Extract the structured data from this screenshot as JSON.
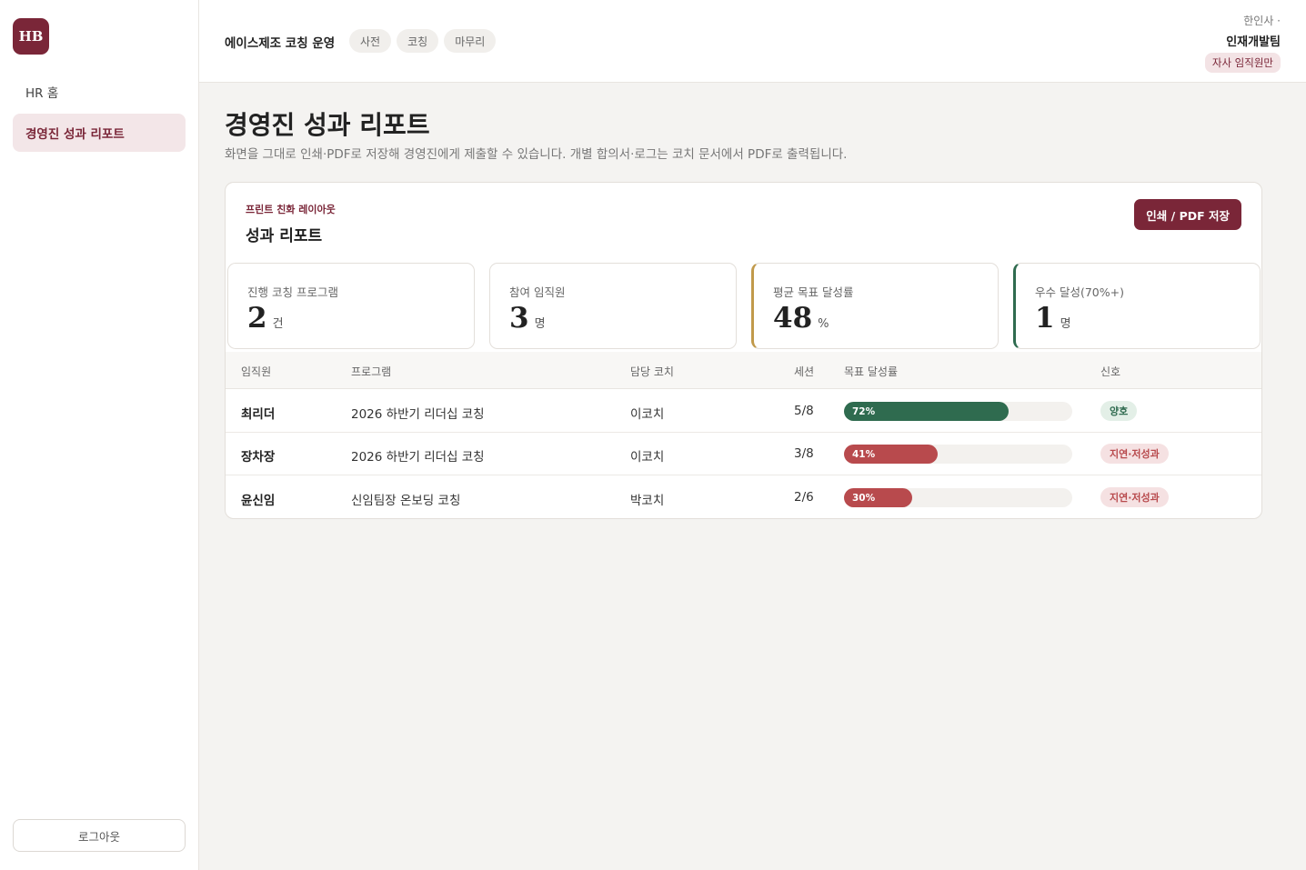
{
  "sidebar": {
    "logo": "HB",
    "items": [
      {
        "label": "HR 홈"
      },
      {
        "label": "경영진 성과 리포트"
      }
    ],
    "logout_label": "로그아웃"
  },
  "header": {
    "app_title": "에이스제조 코칭 운영",
    "phases": [
      "사전",
      "코칭",
      "마무리"
    ],
    "company": "한인사 ·",
    "team": "인재개발팀",
    "scope_badge": "자사 임직원만"
  },
  "main": {
    "title": "경영진 성과 리포트",
    "description": "화면을 그대로 인쇄·PDF로 저장해 경영진에게 제출할 수 있습니다. 개별 합의서·로그는 코치 문서에서 PDF로 출력됩니다.",
    "card": {
      "kicker": "프린트 친화 레이아웃",
      "title": "성과 리포트",
      "print_button": "인쇄 / PDF 저장"
    },
    "stats": [
      {
        "label": "진행 코칭 프로그램",
        "value": "2",
        "unit": "건"
      },
      {
        "label": "참여 임직원",
        "value": "3",
        "unit": "명"
      },
      {
        "label": "평균 목표 달성률",
        "value": "48",
        "unit": "%"
      },
      {
        "label": "우수 달성(70%+)",
        "value": "1",
        "unit": "명"
      }
    ],
    "table": {
      "headers": [
        "임직원",
        "프로그램",
        "담당 코치",
        "세션",
        "목표 달성률",
        "신호"
      ],
      "rows": [
        {
          "name": "최리더",
          "program": "2026 하반기 리더십 코칭",
          "coach": "이코치",
          "session": "5/8",
          "progress": 72,
          "progress_label": "72%",
          "signal": "양호",
          "status": "good"
        },
        {
          "name": "장차장",
          "program": "2026 하반기 리더십 코칭",
          "coach": "이코치",
          "session": "3/8",
          "progress": 41,
          "progress_label": "41%",
          "signal": "지연·저성과",
          "status": "bad"
        },
        {
          "name": "윤신임",
          "program": "신임팀장 온보딩 코칭",
          "coach": "박코치",
          "session": "2/6",
          "progress": 30,
          "progress_label": "30%",
          "signal": "지연·저성과",
          "status": "bad"
        }
      ]
    }
  },
  "colors": {
    "brand": "#7a2638",
    "good": "#2f6b4f",
    "bad": "#b84a4d",
    "accent_gold": "#c19a4b"
  }
}
